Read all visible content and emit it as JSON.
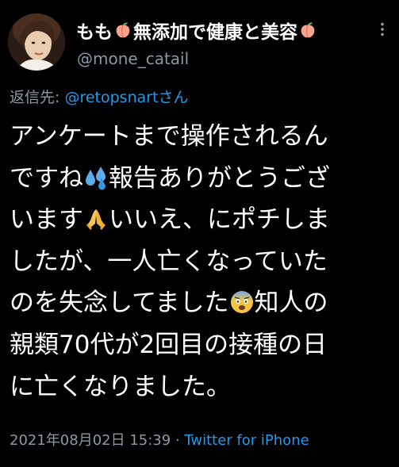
{
  "user": {
    "display_name_part1": "もも",
    "display_name_part2": "無添加で健康と美容",
    "handle": "@mone_catail",
    "name_emoji": "peach-emoji"
  },
  "reply": {
    "prefix": "返信先: ",
    "mention": "@retopsnart",
    "suffix": "さん"
  },
  "tweet": {
    "lines": [
      [
        "アンケートまで操作されるん"
      ],
      [
        "ですね",
        "{sweat}",
        "報告ありがとうござ"
      ],
      [
        "います",
        "{pray}",
        "いいえ、にポチしま"
      ],
      [
        "したが、一人亡くなっていた"
      ],
      [
        "のを失念してました",
        "{fear}",
        "知人の"
      ],
      [
        "親類70代が2回目の接種の日"
      ],
      [
        "に亡くなりました。"
      ]
    ],
    "line_1": "アンケートまで操作されるん",
    "line_2a": "ですね",
    "line_2b": "報告ありがとうござ",
    "line_3a": "います",
    "line_3b": "いいえ、にポチしま",
    "line_4": "したが、一人亡くなっていた",
    "line_5a": "のを失念してました",
    "line_5b": "知人の",
    "line_6": "親類70代が2回目の接種の日",
    "line_7": "に亡くなりました。",
    "emoji_sweat": "sweat-droplets-emoji",
    "emoji_pray": "folded-hands-emoji",
    "emoji_fear": "fearful-face-emoji"
  },
  "meta": {
    "timestamp": "2021年08月02日 15:39",
    "separator": " · ",
    "source": "Twitter for iPhone"
  },
  "colors": {
    "background": "#000000",
    "text": "#ffffff",
    "secondary": "#8b98a5",
    "link": "#1d9bf0"
  }
}
